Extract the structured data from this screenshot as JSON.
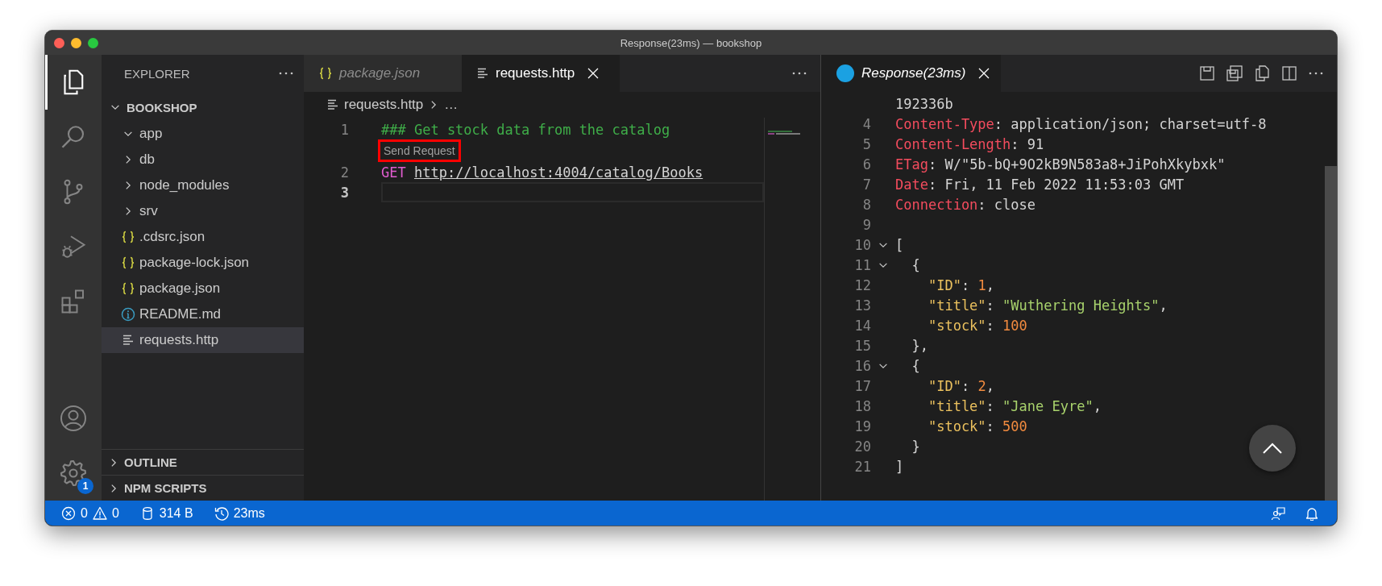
{
  "window": {
    "title": "Response(23ms) — bookshop"
  },
  "activity_bar": {
    "items": [
      {
        "kind": "files",
        "selected": true
      },
      {
        "kind": "search",
        "selected": false
      },
      {
        "kind": "source-control",
        "selected": false
      },
      {
        "kind": "run-debug",
        "selected": false
      },
      {
        "kind": "extensions",
        "selected": false
      }
    ],
    "bottom": [
      {
        "kind": "account"
      },
      {
        "kind": "settings",
        "badge": "1"
      }
    ]
  },
  "sidebar": {
    "title": "EXPLORER",
    "tree": [
      {
        "label": "BOOKSHOP",
        "kind": "root",
        "expanded": true,
        "selected": false,
        "children": [
          {
            "label": "app",
            "kind": "folder",
            "expanded": true,
            "selected": false
          },
          {
            "label": "db",
            "kind": "folder",
            "expanded": false,
            "selected": false
          },
          {
            "label": "node_modules",
            "kind": "folder",
            "expanded": false,
            "selected": false
          },
          {
            "label": "srv",
            "kind": "folder",
            "expanded": false,
            "selected": false
          },
          {
            "label": ".cdsrc.json",
            "kind": "json",
            "selected": false
          },
          {
            "label": "package-lock.json",
            "kind": "json",
            "selected": false
          },
          {
            "label": "package.json",
            "kind": "json",
            "selected": false
          },
          {
            "label": "README.md",
            "kind": "info",
            "selected": false
          },
          {
            "label": "requests.http",
            "kind": "http",
            "selected": true
          }
        ]
      }
    ],
    "sections": [
      {
        "label": "OUTLINE",
        "expanded": false
      },
      {
        "label": "NPM SCRIPTS",
        "expanded": false
      }
    ]
  },
  "left_editor": {
    "tabs": [
      {
        "label": "package.json",
        "kind": "json",
        "selected": false,
        "preview": true
      },
      {
        "label": "requests.http",
        "kind": "http",
        "selected": true,
        "preview": false
      }
    ],
    "breadcrumb": [
      "requests.http",
      "…"
    ],
    "lines": [
      {
        "number": "1",
        "current": false,
        "tokens": [
          {
            "kind": "comment",
            "text": "### Get stock data from the catalog"
          }
        ]
      },
      {
        "number": "2",
        "current": false,
        "codelens": {
          "text": "Send Request",
          "highlighted": true
        },
        "tokens": [
          {
            "kind": "keyword",
            "text": "GET "
          },
          {
            "kind": "link",
            "text": "http://localhost:4004/catalog/Books"
          }
        ]
      },
      {
        "number": "3",
        "current": true
      }
    ]
  },
  "right_editor": {
    "tabs": [
      {
        "label": "Response(23ms)",
        "kind": "response",
        "selected": true,
        "preview": true
      }
    ],
    "lines": [
      {
        "tokens": [
          {
            "kind": "plain",
            "text": "192336b"
          }
        ]
      },
      {
        "number": "4",
        "fold": false,
        "tokens": [
          {
            "kind": "header",
            "text": "Content-Type"
          },
          {
            "kind": "plain",
            "text": ": application/json; charset=utf-8"
          }
        ]
      },
      {
        "number": "5",
        "fold": false,
        "tokens": [
          {
            "kind": "header",
            "text": "Content-Length"
          },
          {
            "kind": "plain",
            "text": ": 91"
          }
        ]
      },
      {
        "number": "6",
        "fold": false,
        "tokens": [
          {
            "kind": "header",
            "text": "ETag"
          },
          {
            "kind": "plain",
            "text": ": W/\"5b-bQ+9O2kB9N583a8+JiPohXkybxk\""
          }
        ]
      },
      {
        "number": "7",
        "fold": false,
        "tokens": [
          {
            "kind": "header",
            "text": "Date"
          },
          {
            "kind": "plain",
            "text": ": Fri, 11 Feb 2022 11:53:03 GMT"
          }
        ]
      },
      {
        "number": "8",
        "fold": false,
        "tokens": [
          {
            "kind": "header",
            "text": "Connection"
          },
          {
            "kind": "plain",
            "text": ": close"
          }
        ]
      },
      {
        "number": "9",
        "fold": false
      },
      {
        "number": "10",
        "fold": true,
        "tokens": [
          {
            "kind": "plain",
            "text": "["
          }
        ]
      },
      {
        "number": "11",
        "fold": true,
        "tokens": [
          {
            "kind": "plain",
            "text": "  {"
          }
        ]
      },
      {
        "number": "12",
        "fold": false,
        "tokens": [
          {
            "kind": "key",
            "text": "    \"ID\""
          },
          {
            "kind": "plain",
            "text": ": "
          },
          {
            "kind": "number",
            "text": "1"
          },
          {
            "kind": "plain",
            "text": ","
          }
        ]
      },
      {
        "number": "13",
        "fold": false,
        "tokens": [
          {
            "kind": "key",
            "text": "    \"title\""
          },
          {
            "kind": "plain",
            "text": ": "
          },
          {
            "kind": "string",
            "text": "\"Wuthering Heights\""
          },
          {
            "kind": "plain",
            "text": ","
          }
        ]
      },
      {
        "number": "14",
        "fold": false,
        "tokens": [
          {
            "kind": "key",
            "text": "    \"stock\""
          },
          {
            "kind": "plain",
            "text": ": "
          },
          {
            "kind": "number",
            "text": "100"
          }
        ]
      },
      {
        "number": "15",
        "fold": false,
        "tokens": [
          {
            "kind": "plain",
            "text": "  },"
          }
        ]
      },
      {
        "number": "16",
        "fold": true,
        "tokens": [
          {
            "kind": "plain",
            "text": "  {"
          }
        ]
      },
      {
        "number": "17",
        "fold": false,
        "tokens": [
          {
            "kind": "key",
            "text": "    \"ID\""
          },
          {
            "kind": "plain",
            "text": ": "
          },
          {
            "kind": "number",
            "text": "2"
          },
          {
            "kind": "plain",
            "text": ","
          }
        ]
      },
      {
        "number": "18",
        "fold": false,
        "tokens": [
          {
            "kind": "key",
            "text": "    \"title\""
          },
          {
            "kind": "plain",
            "text": ": "
          },
          {
            "kind": "string",
            "text": "\"Jane Eyre\""
          },
          {
            "kind": "plain",
            "text": ","
          }
        ]
      },
      {
        "number": "19",
        "fold": false,
        "tokens": [
          {
            "kind": "key",
            "text": "    \"stock\""
          },
          {
            "kind": "plain",
            "text": ": "
          },
          {
            "kind": "number",
            "text": "500"
          }
        ]
      },
      {
        "number": "20",
        "fold": false,
        "tokens": [
          {
            "kind": "plain",
            "text": "  }"
          }
        ]
      },
      {
        "number": "21",
        "fold": false,
        "tokens": [
          {
            "kind": "plain",
            "text": "]"
          }
        ]
      }
    ]
  },
  "status_bar": {
    "left": [
      {
        "kind": "errors",
        "text": "0"
      },
      {
        "kind": "warnings",
        "text": "0"
      },
      {
        "kind": "size",
        "text": "314 B"
      },
      {
        "kind": "duration",
        "text": "23ms"
      }
    ],
    "right": [
      {
        "kind": "feedback"
      },
      {
        "kind": "notifications"
      }
    ]
  }
}
